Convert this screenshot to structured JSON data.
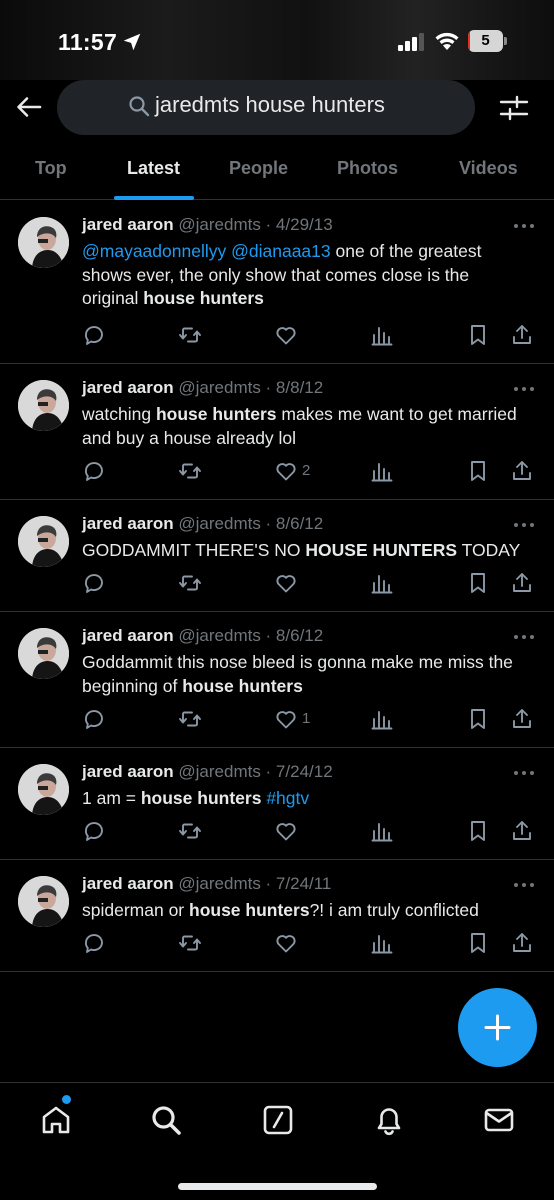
{
  "status_bar": {
    "time": "11:57",
    "battery_level": "5",
    "battery_fraction": 0.05
  },
  "search": {
    "query": "jaredmts house hunters"
  },
  "tabs": [
    {
      "label": "Top",
      "active": false
    },
    {
      "label": "Latest",
      "active": true
    },
    {
      "label": "People",
      "active": false
    },
    {
      "label": "Photos",
      "active": false
    },
    {
      "label": "Videos",
      "active": false
    }
  ],
  "tweets": [
    {
      "name": "jared aaron",
      "meta": "@jaredmts · 4/29/13",
      "body": [
        {
          "text": "@mayaadonnellyy",
          "style": "link"
        },
        {
          "text": " ",
          "style": "plain"
        },
        {
          "text": "@dianaaa13",
          "style": "link"
        },
        {
          "text": " one of the greatest shows ever, the only show that comes close is the original ",
          "style": "plain"
        },
        {
          "text": "house hunters",
          "style": "bold"
        }
      ],
      "like_count": ""
    },
    {
      "name": "jared aaron",
      "meta": "@jaredmts · 8/8/12",
      "body": [
        {
          "text": "watching ",
          "style": "plain"
        },
        {
          "text": "house hunters",
          "style": "bold"
        },
        {
          "text": " makes me want to get married and buy a house already lol",
          "style": "plain"
        }
      ],
      "like_count": "2"
    },
    {
      "name": "jared aaron",
      "meta": "@jaredmts · 8/6/12",
      "body": [
        {
          "text": "GODDAMMIT THERE'S NO ",
          "style": "plain"
        },
        {
          "text": "HOUSE HUNTERS",
          "style": "bold"
        },
        {
          "text": " TODAY",
          "style": "plain"
        }
      ],
      "like_count": ""
    },
    {
      "name": "jared aaron",
      "meta": "@jaredmts · 8/6/12",
      "body": [
        {
          "text": "Goddammit this nose bleed is gonna make me miss the beginning of ",
          "style": "plain"
        },
        {
          "text": "house hunters",
          "style": "bold"
        }
      ],
      "like_count": "1"
    },
    {
      "name": "jared aaron",
      "meta": "@jaredmts · 7/24/12",
      "body": [
        {
          "text": "1 am = ",
          "style": "plain"
        },
        {
          "text": "house hunters",
          "style": "bold"
        },
        {
          "text": " ",
          "style": "plain"
        },
        {
          "text": "#hgtv",
          "style": "link"
        }
      ],
      "like_count": ""
    },
    {
      "name": "jared aaron",
      "meta": "@jaredmts · 7/24/11",
      "body": [
        {
          "text": "spiderman or ",
          "style": "plain"
        },
        {
          "text": "house hunters",
          "style": "bold"
        },
        {
          "text": "?! i am truly conflicted",
          "style": "plain"
        }
      ],
      "like_count": ""
    }
  ],
  "bottom_nav": [
    {
      "icon": "home-icon",
      "has_badge": true
    },
    {
      "icon": "search-icon",
      "has_badge": false
    },
    {
      "icon": "grok-icon",
      "has_badge": false
    },
    {
      "icon": "bell-icon",
      "has_badge": false
    },
    {
      "icon": "mail-icon",
      "has_badge": false
    }
  ],
  "colors": {
    "accent": "#1d9bf0",
    "background": "#000000",
    "text_primary": "#e7e9ea",
    "text_secondary": "#71767b",
    "divider": "#2f3336",
    "search_field": "#202327"
  }
}
